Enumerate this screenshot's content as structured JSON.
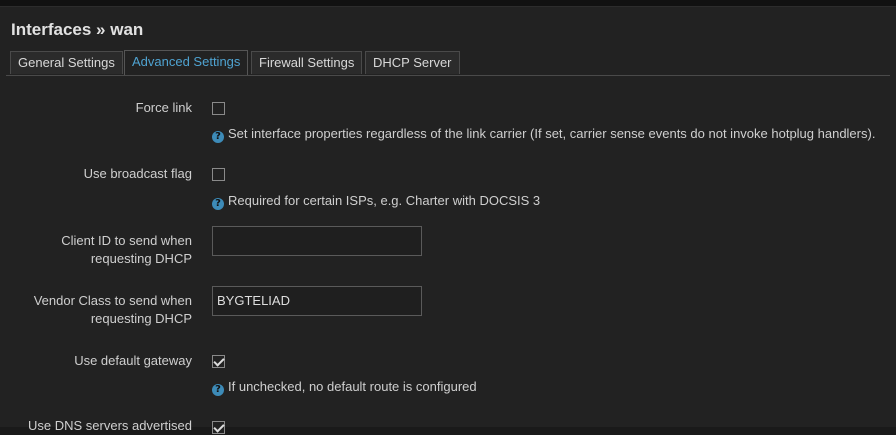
{
  "page": {
    "title": "Interfaces » wan"
  },
  "tabs": [
    {
      "label": "General Settings",
      "active": false
    },
    {
      "label": "Advanced Settings",
      "active": true
    },
    {
      "label": "Firewall Settings",
      "active": false
    },
    {
      "label": "DHCP Server",
      "active": false
    }
  ],
  "fields": {
    "force_link": {
      "label": "Force link",
      "checked": false,
      "help": "Set interface properties regardless of the link carrier (If set, carrier sense events do not invoke hotplug handlers)."
    },
    "broadcast_flag": {
      "label": "Use broadcast flag",
      "checked": false,
      "help": "Required for certain ISPs, e.g. Charter with DOCSIS 3"
    },
    "client_id": {
      "label_line1": "Client ID to send when",
      "label_line2": "requesting DHCP",
      "value": ""
    },
    "vendor_class": {
      "label_line1": "Vendor Class to send when",
      "label_line2": "requesting DHCP",
      "value": "BYGTELIAD"
    },
    "default_gateway": {
      "label": "Use default gateway",
      "checked": true,
      "help": "If unchecked, no default route is configured"
    },
    "dns_advertised": {
      "label": "Use DNS servers advertised",
      "checked": true
    }
  },
  "colors": {
    "accent": "#4fa3d1",
    "background": "#222222",
    "help_icon": "#3d8bb8"
  },
  "icons": {
    "help": "question-circle-icon",
    "check": "checkmark-icon"
  }
}
